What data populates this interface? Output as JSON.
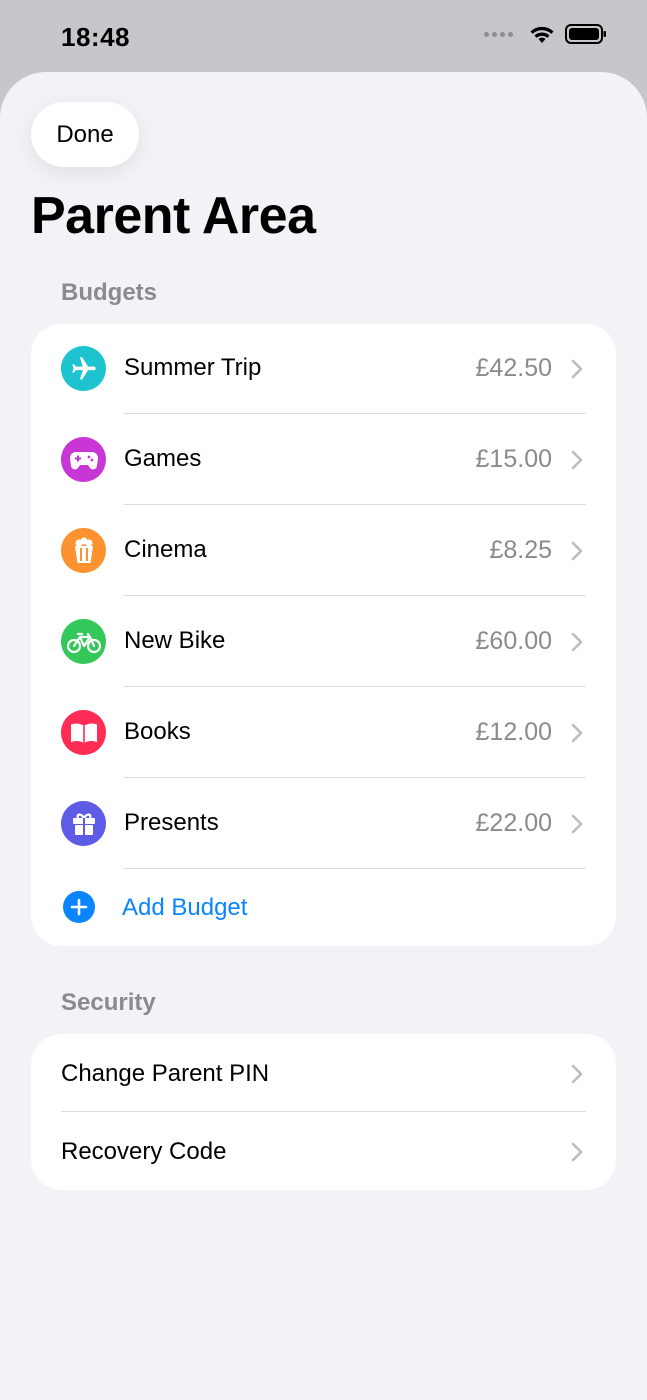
{
  "status_bar": {
    "time": "18:48"
  },
  "sheet": {
    "done_label": "Done",
    "title": "Parent Area"
  },
  "budgets": {
    "section_label": "Budgets",
    "items": [
      {
        "name": "Summer Trip",
        "amount": "£42.50",
        "icon": "airplane-icon",
        "color": "#1dc4cf"
      },
      {
        "name": "Games",
        "amount": "£15.00",
        "icon": "gamecontroller-icon",
        "color": "#c936d6"
      },
      {
        "name": "Cinema",
        "amount": "£8.25",
        "icon": "popcorn-icon",
        "color": "#ff9230"
      },
      {
        "name": "New Bike",
        "amount": "£60.00",
        "icon": "bicycle-icon",
        "color": "#34c759"
      },
      {
        "name": "Books",
        "amount": "£12.00",
        "icon": "book-icon",
        "color": "#ff2d55"
      },
      {
        "name": "Presents",
        "amount": "£22.00",
        "icon": "gift-icon",
        "color": "#5e5ce6"
      }
    ],
    "add_label": "Add Budget"
  },
  "security": {
    "section_label": "Security",
    "items": [
      {
        "label": "Change Parent PIN"
      },
      {
        "label": "Recovery Code"
      }
    ]
  },
  "colors": {
    "accent": "#0a84ff",
    "background": "#f2f2f7",
    "secondary_text": "#8a8a8f"
  }
}
